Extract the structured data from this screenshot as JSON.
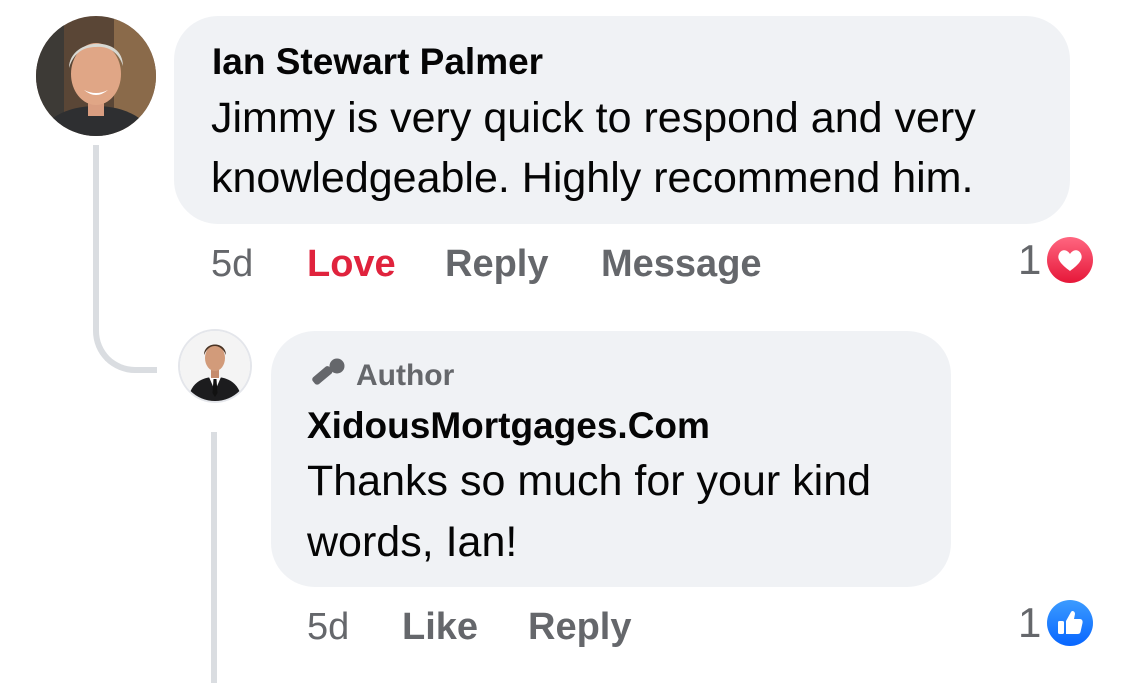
{
  "comment": {
    "author": "Ian Stewart Palmer",
    "text_line1": "Jimmy is very quick to respond and very",
    "text_line2": "knowledgeable. Highly recommend him.",
    "actions": {
      "time": "5d",
      "reaction_label": "Love",
      "reply": "Reply",
      "message": "Message"
    },
    "reaction": {
      "count": "1",
      "icon": "love-heart-icon",
      "color": "#f0374f"
    }
  },
  "reply": {
    "badge": {
      "label": "Author",
      "icon": "microphone-icon"
    },
    "author": "XidousMortgages.Com",
    "text_line1": "Thanks so much for your kind",
    "text_line2": "words, Ian!",
    "actions": {
      "time": "5d",
      "like": "Like",
      "reply": "Reply"
    },
    "reaction": {
      "count": "1",
      "icon": "like-thumb-icon",
      "color": "#1877f2"
    }
  },
  "colors": {
    "bubble": "#f0f2f5",
    "secondary_text": "#65676b",
    "love": "#e0233d",
    "thread_line": "#dadde1"
  }
}
